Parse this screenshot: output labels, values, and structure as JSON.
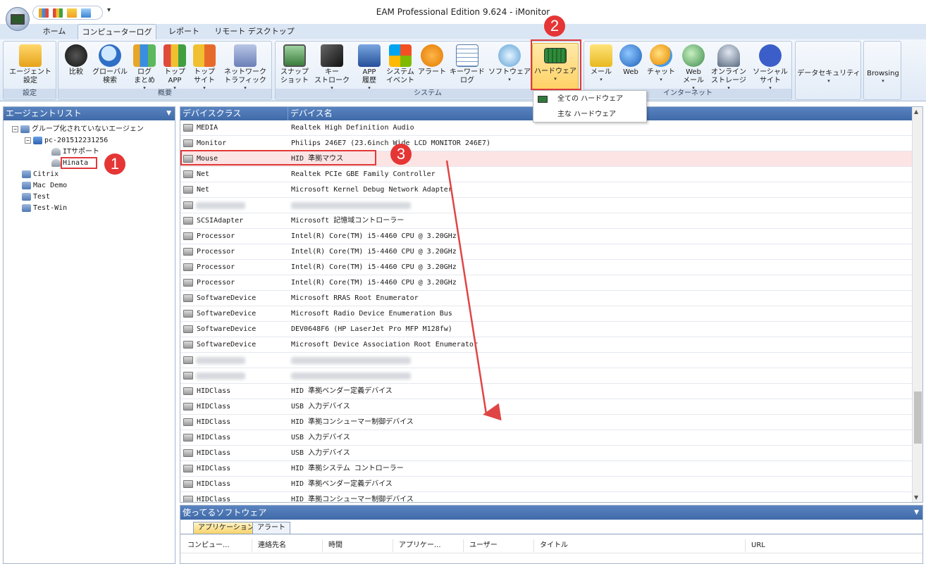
{
  "window_title": "EAM Professional Edition 9.624 - iMonitor",
  "tabs": [
    "ホーム",
    "コンピューターログ",
    "レポート",
    "リモート デスクトップ"
  ],
  "ribbon": {
    "groups": [
      "設定",
      "概要",
      "システム",
      "インターネット"
    ],
    "buttons": {
      "agent_settings": "エージェント\n設定",
      "compare": "比較",
      "global_search": "グローバル\n検索",
      "log_summary": "ログ\nまとめ",
      "top_app": "トップ\nAPP",
      "top_site": "トップ\nサイト",
      "network_traffic": "ネットワーク\nトラフィック",
      "snapshot": "スナップ\nショット",
      "keystroke": "キー\nストローク",
      "app_history": "APP\n履歴",
      "system_event": "システム\nイベント",
      "alert": "アラート",
      "keyword_log": "キーワード\nログ",
      "software": "ソフトウェア",
      "hardware": "ハードウェア",
      "mail": "メール",
      "web": "Web",
      "chat": "チャット",
      "web_mail": "Web\nメール",
      "online_storage": "オンライン\nストレージ",
      "social_site": "ソーシャル\nサイト",
      "data_security": "データセキュリティ",
      "browsing": "Browsing"
    }
  },
  "hardware_menu": [
    "全ての ハードウェア",
    "主な ハードウェア"
  ],
  "left_panel": {
    "title": "エージェントリスト",
    "tree": [
      "グループ化されていないエージェン",
      "pc-201512231256",
      "ITサポート",
      "Hinata",
      "Citrix",
      "Mac Demo",
      "Test",
      "Test-Win"
    ]
  },
  "grid": {
    "columns": [
      "デバイスクラス",
      "デバイス名"
    ],
    "rows": [
      {
        "cls": "MEDIA",
        "name": "Realtek High Definition Audio"
      },
      {
        "cls": "Monitor",
        "name": "Philips 246E7 (23.6inch Wide LCD MONITOR 246E7)"
      },
      {
        "cls": "Mouse",
        "name": "HID 準拠マウス"
      },
      {
        "cls": "Net",
        "name": "Realtek PCIe GBE Family Controller"
      },
      {
        "cls": "Net",
        "name": "Microsoft Kernel Debug Network Adapter"
      },
      {
        "cls": "",
        "name": ""
      },
      {
        "cls": "SCSIAdapter",
        "name": "Microsoft 記憶域コントローラー"
      },
      {
        "cls": "Processor",
        "name": "Intel(R) Core(TM) i5-4460  CPU @ 3.20GHz"
      },
      {
        "cls": "Processor",
        "name": "Intel(R) Core(TM) i5-4460  CPU @ 3.20GHz"
      },
      {
        "cls": "Processor",
        "name": "Intel(R) Core(TM) i5-4460  CPU @ 3.20GHz"
      },
      {
        "cls": "Processor",
        "name": "Intel(R) Core(TM) i5-4460  CPU @ 3.20GHz"
      },
      {
        "cls": "SoftwareDevice",
        "name": "Microsoft RRAS Root Enumerator"
      },
      {
        "cls": "SoftwareDevice",
        "name": "Microsoft Radio Device Enumeration Bus"
      },
      {
        "cls": "SoftwareDevice",
        "name": "DEV0648F6 (HP LaserJet Pro MFP M128fw)"
      },
      {
        "cls": "SoftwareDevice",
        "name": "Microsoft Device Association Root Enumerator"
      },
      {
        "cls": "",
        "name": ""
      },
      {
        "cls": "",
        "name": ""
      },
      {
        "cls": "HIDClass",
        "name": "HID 準拠ベンダー定義デバイス"
      },
      {
        "cls": "HIDClass",
        "name": "USB 入力デバイス"
      },
      {
        "cls": "HIDClass",
        "name": "HID 準拠コンシューマー制御デバイス"
      },
      {
        "cls": "HIDClass",
        "name": "USB 入力デバイス"
      },
      {
        "cls": "HIDClass",
        "name": "USB 入力デバイス"
      },
      {
        "cls": "HIDClass",
        "name": "HID 準拠システム コントローラー"
      },
      {
        "cls": "HIDClass",
        "name": "HID 準拠ベンダー定義デバイス"
      },
      {
        "cls": "HIDClass",
        "name": "HID 準拠コンシューマー制御デバイス"
      }
    ]
  },
  "bottom_panel": {
    "title": "使ってるソフトウェア",
    "tabs": [
      "アプリケーション",
      "アラート"
    ],
    "columns": [
      "コンピュー...",
      "連絡先名",
      "時間",
      "アプリケー...",
      "ユーザー",
      "タイトル",
      "URL"
    ]
  },
  "annotations": [
    "1",
    "2",
    "3"
  ],
  "colors": {
    "annotation_red": "#e53535",
    "header_blue": "#4a76b4",
    "selected_row": "#fde4e4"
  }
}
